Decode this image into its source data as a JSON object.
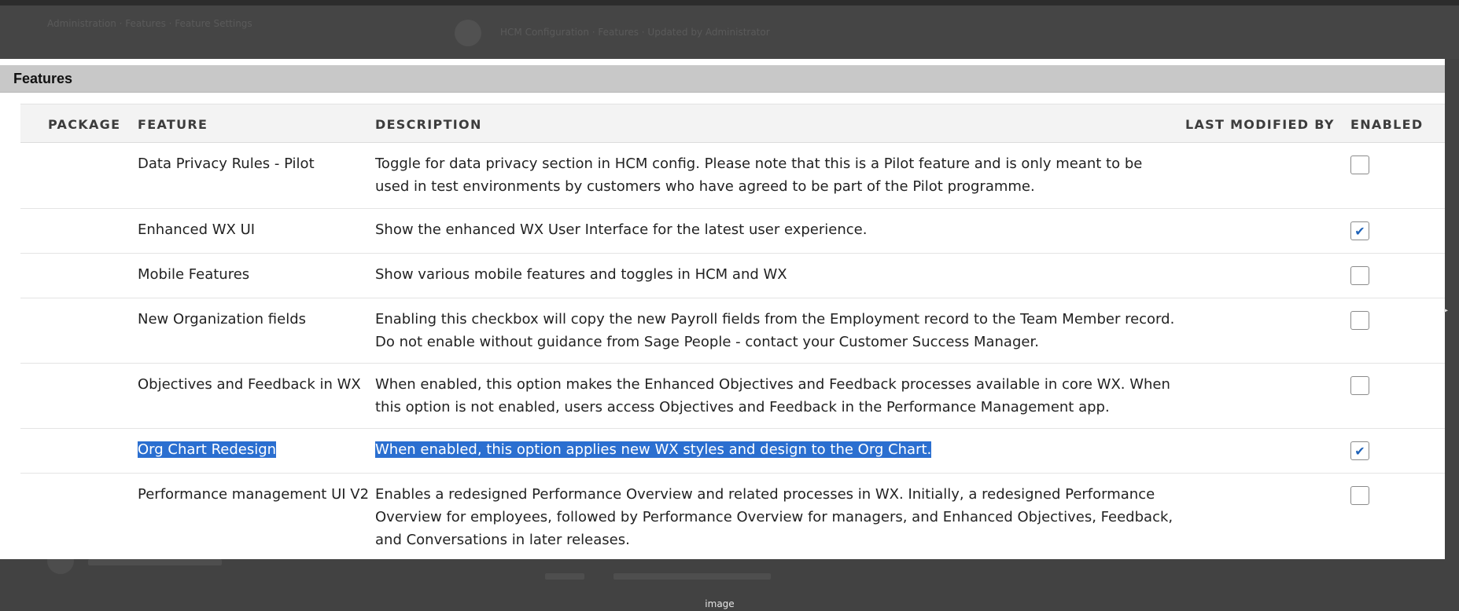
{
  "background": {
    "color": "#424242",
    "dim_header_text": "Administration  ·  Features  ·  Feature Settings",
    "dim_notification_text": "HCM Configuration  ·  Features  ·  Updated by Administrator"
  },
  "panel": {
    "title": "Features"
  },
  "table": {
    "columns": {
      "package": "PACKAGE",
      "feature": "FEATURE",
      "description": "DESCRIPTION",
      "last_modified_by": "LAST MODIFIED BY",
      "enabled": "ENABLED"
    },
    "rows": [
      {
        "package": "",
        "feature": "Data Privacy Rules - Pilot",
        "description": "Toggle for data privacy section in HCM config. Please note that this is a Pilot feature and is only meant to be used in test environments by customers who have agreed to be part of the Pilot programme.",
        "last_modified_by": "",
        "enabled": false,
        "selected": false
      },
      {
        "package": "",
        "feature": "Enhanced WX UI",
        "description": "Show the enhanced WX User Interface for the latest user experience.",
        "last_modified_by": "",
        "enabled": true,
        "selected": false
      },
      {
        "package": "",
        "feature": "Mobile Features",
        "description": "Show various mobile features and toggles in HCM and WX",
        "last_modified_by": "",
        "enabled": false,
        "selected": false
      },
      {
        "package": "",
        "feature": "New Organization fields",
        "description": "Enabling this checkbox will copy the new Payroll fields from the Employment record to the Team Member record. Do not enable without guidance from Sage People - contact your Customer Success Manager.",
        "last_modified_by": "",
        "enabled": false,
        "selected": false
      },
      {
        "package": "",
        "feature": "Objectives and Feedback in WX",
        "description": "When enabled, this option makes the Enhanced Objectives and Feedback processes available in core WX. When this option is not enabled, users access Objectives and Feedback in the Performance Management app.",
        "last_modified_by": "",
        "enabled": false,
        "selected": false
      },
      {
        "package": "",
        "feature": "Org Chart Redesign",
        "description": "When enabled, this option applies new WX styles and design to the Org Chart.",
        "last_modified_by": "",
        "enabled": true,
        "selected": true
      },
      {
        "package": "",
        "feature": "Performance management UI V2",
        "description": "Enables a redesigned Performance Overview and related processes in WX. Initially, a redesigned Performance Overview for employees, followed by Performance Overview for managers, and Enhanced Objectives, Feedback, and Conversations in later releases.",
        "last_modified_by": "",
        "enabled": false,
        "selected": false
      }
    ]
  },
  "checkbox_mark": "✔",
  "caption": "image",
  "colors": {
    "selection": "#2b6fd0",
    "header_bar": "#c8c8c8",
    "check_accent": "#1f62b8"
  }
}
